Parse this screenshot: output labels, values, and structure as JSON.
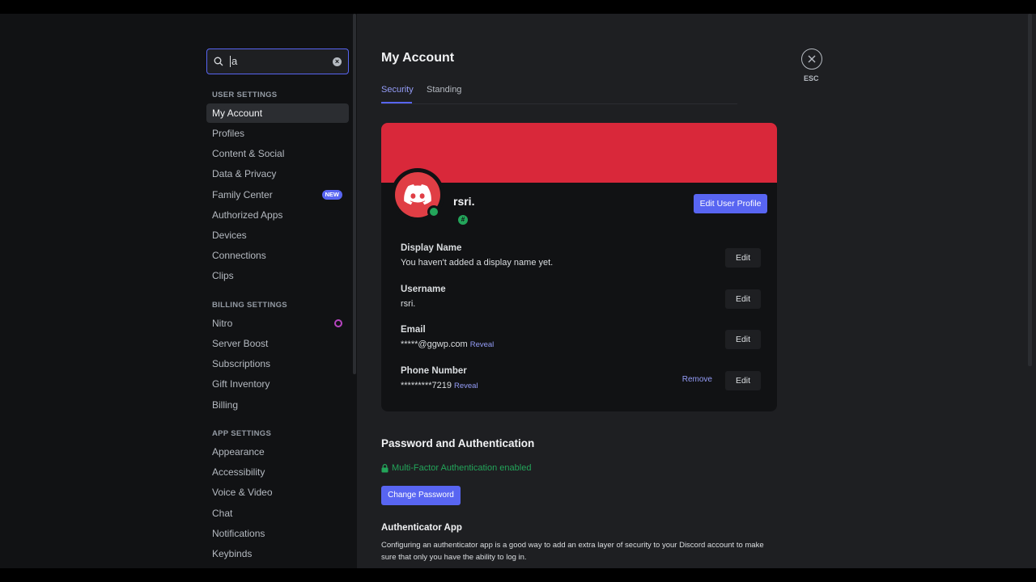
{
  "search": {
    "value": "a"
  },
  "sidebar": {
    "sections": [
      {
        "label": "USER SETTINGS"
      },
      {
        "label": "BILLING SETTINGS"
      },
      {
        "label": "APP SETTINGS"
      }
    ],
    "user_items": [
      {
        "label": "My Account",
        "active": true
      },
      {
        "label": "Profiles"
      },
      {
        "label": "Content & Social"
      },
      {
        "label": "Data & Privacy"
      },
      {
        "label": "Family Center",
        "badge": "NEW"
      },
      {
        "label": "Authorized Apps"
      },
      {
        "label": "Devices"
      },
      {
        "label": "Connections"
      },
      {
        "label": "Clips"
      }
    ],
    "billing_items": [
      {
        "label": "Nitro"
      },
      {
        "label": "Server Boost"
      },
      {
        "label": "Subscriptions"
      },
      {
        "label": "Gift Inventory"
      },
      {
        "label": "Billing"
      }
    ],
    "app_items": [
      {
        "label": "Appearance"
      },
      {
        "label": "Accessibility"
      },
      {
        "label": "Voice & Video"
      },
      {
        "label": "Chat"
      },
      {
        "label": "Notifications"
      },
      {
        "label": "Keybinds"
      }
    ]
  },
  "main": {
    "title": "My Account",
    "tabs": [
      {
        "label": "Security",
        "active": true
      },
      {
        "label": "Standing"
      }
    ],
    "esc_label": "ESC",
    "profile": {
      "username": "rsri.",
      "badge": "#",
      "edit_profile_label": "Edit User Profile",
      "banner_color": "#d9283a"
    },
    "fields": [
      {
        "label": "Display Name",
        "value": "You haven't added a display name yet.",
        "edit": "Edit"
      },
      {
        "label": "Username",
        "value": "rsri.",
        "edit": "Edit"
      },
      {
        "label": "Email",
        "value": "*****@ggwp.com",
        "reveal": "Reveal",
        "edit": "Edit"
      },
      {
        "label": "Phone Number",
        "value": "*********7219",
        "reveal": "Reveal",
        "remove": "Remove",
        "edit": "Edit"
      }
    ],
    "password_section": {
      "title": "Password and Authentication",
      "mfa_status": "Multi-Factor Authentication enabled",
      "change_password_label": "Change Password",
      "authenticator_title": "Authenticator App",
      "authenticator_desc": "Configuring an authenticator app is a good way to add an extra layer of security to your Discord account to make sure that only you have the ability to log in."
    }
  },
  "colors": {
    "accent": "#5865f2",
    "success": "#23a55a",
    "link": "#949cf7"
  }
}
